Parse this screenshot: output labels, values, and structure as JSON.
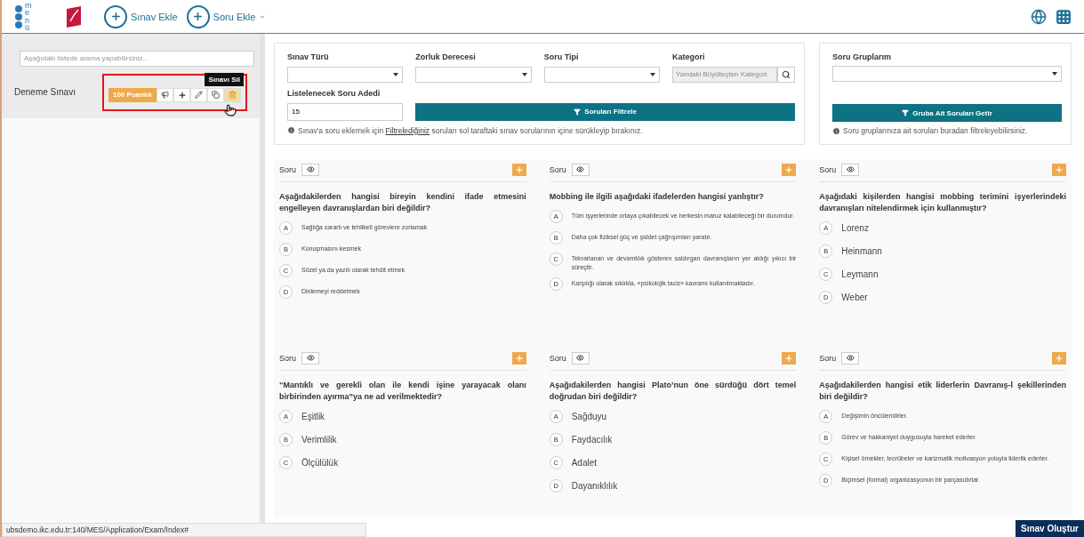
{
  "topbar": {
    "menu_label": "menü",
    "actions": [
      {
        "label": "Sınav Ekle",
        "dropdown": false
      },
      {
        "label": "Soru Ekle",
        "dropdown": true
      }
    ]
  },
  "sidebar": {
    "search_placeholder": "Aşağıdaki listede arama yapabilirsiniz...",
    "exams": [
      {
        "name": "Deneme Sınavı",
        "points": "100 Puanlık",
        "tooltip": "Sınavı Sil",
        "highlighted": true
      }
    ]
  },
  "filters": {
    "fields": [
      {
        "label": "Sınav Türü",
        "kind": "select"
      },
      {
        "label": "Zorluk Derecesi",
        "kind": "select"
      },
      {
        "label": "Soru Tipi",
        "kind": "select"
      },
      {
        "label": "Kategori",
        "kind": "search",
        "placeholder": "Yandaki Büyüteçten Kategori"
      }
    ],
    "count_label": "Listelenecek Soru Adedi",
    "count_value": "15",
    "filter_button": "Soruları Filtrele",
    "info_pre": "Sınav'a soru eklemek için",
    "info_link": "Filtrelediğiniz",
    "info_post": "soruları sol taraftaki sınav sorularının içine sürükleyip bırakınız."
  },
  "groups": {
    "label": "Soru Gruplarım",
    "button": "Gruba Ait Soruları Getir",
    "info": "Soru gruplarınıza ait soruları buradan filtreleyebilirsiniz."
  },
  "questions": [
    {
      "header": "Soru",
      "kind": "small",
      "text": "Aşağıdakilerden hangisi bireyin kendini ifade etmesini engelleyen davranışlardan biri değildir?",
      "options": [
        {
          "letter": "A",
          "text": "Sağlığa zararlı ve tehlikeli görevlere zorlamak"
        },
        {
          "letter": "B",
          "text": "Konuşmasını kesmek"
        },
        {
          "letter": "C",
          "text": "Sözel ya da yazılı olarak tehdit etmek"
        },
        {
          "letter": "D",
          "text": "Dinlemeyi reddetmek"
        }
      ]
    },
    {
      "header": "Soru",
      "kind": "small",
      "text": "Mobbing ile ilgili aşağıdaki ifadelerden hangisi yanlıştır?",
      "options": [
        {
          "letter": "A",
          "text": "Tüm işyerlerinde ortaya çıkabilecek ve herkesin maruz kalabileceği bir durumdur."
        },
        {
          "letter": "B",
          "text": "Daha çok fiziksel güç ve şiddet çağrışımları yaratır."
        },
        {
          "letter": "C",
          "text": "Tekrarlanan ve devamlılık gösteren saldırgan davranışların yer aldığı yıkıcı bir süreçtir."
        },
        {
          "letter": "D",
          "text": "Karşılığı olarak sıklıkla, «psikolojik taciz» kavramı kullanılmaktadır."
        }
      ]
    },
    {
      "header": "Soru",
      "kind": "large",
      "text": "Aşağıdaki kişilerden hangisi mobbing terimini işyerlerindeki davranışları nitelendirmek için kullanmıştır?",
      "options": [
        {
          "letter": "A",
          "text": "Lorenz"
        },
        {
          "letter": "B",
          "text": "Heinmann"
        },
        {
          "letter": "C",
          "text": "Leymann"
        },
        {
          "letter": "D",
          "text": "Weber"
        }
      ]
    },
    {
      "header": "Soru",
      "kind": "large",
      "text": "“Mantıklı ve gerekli olan ile kendi işine yarayacak olanı birbirinden ayırma”ya ne ad verilmektedir?",
      "options": [
        {
          "letter": "A",
          "text": "Eşitlik"
        },
        {
          "letter": "B",
          "text": "Verimlilik"
        },
        {
          "letter": "C",
          "text": "Ölçülülük"
        }
      ]
    },
    {
      "header": "Soru",
      "kind": "large",
      "text": "Aşağıdakilerden hangisi Plato’nun öne sürdüğü dört temel doğrudan biri değildir?",
      "options": [
        {
          "letter": "A",
          "text": "Sağduyu"
        },
        {
          "letter": "B",
          "text": "Faydacılık"
        },
        {
          "letter": "C",
          "text": "Adalet"
        },
        {
          "letter": "D",
          "text": "Dayanıklılık"
        }
      ]
    },
    {
      "header": "Soru",
      "kind": "small",
      "text": "Aşağıdakilerden hangisi etik liderlerin Davranış-l şekillerinden biri değildir?",
      "options": [
        {
          "letter": "A",
          "text": "Değişimin öncüleridirler."
        },
        {
          "letter": "B",
          "text": "Görev ve hakkaniyet duygusuyla hareket ederler."
        },
        {
          "letter": "C",
          "text": "Kişisel örnekler, tecrübeler ve karizmatik motivasyon yoluyla liderlik ederler."
        },
        {
          "letter": "D",
          "text": "Biçimsel (formal) organizasyonun bir parçasıdırlar."
        }
      ]
    }
  ],
  "status_url": "ubsdemo.ikc.edu.tr:140/MES/Application/Exam/Index#",
  "create_button": "Sınav Oluştur"
}
